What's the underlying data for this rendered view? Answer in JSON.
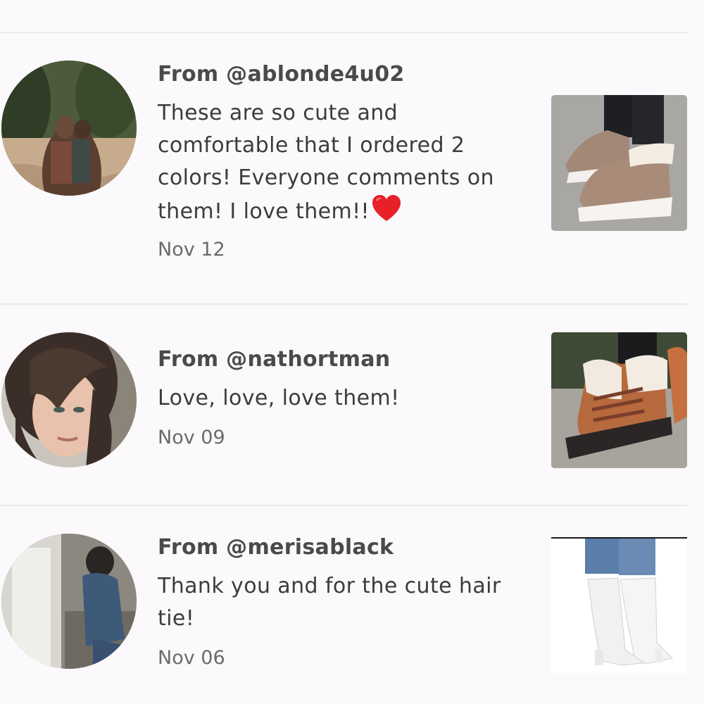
{
  "reviews": [
    {
      "author": "From @ablonde4u02",
      "comment": "These are so cute and comfortable that I ordered 2 colors! Everyone comments on them! I love them!!",
      "emoji": "heart-emoji",
      "date": "Nov 12",
      "avatar": "couple-in-field-photo",
      "product": "tan-fur-wedge-boots-photo"
    },
    {
      "author": "From @nathortman",
      "comment": "Love, love, love them!",
      "date": "Nov 09",
      "avatar": "woman-selfie-photo",
      "product": "brown-lace-up-fur-boots-photo"
    },
    {
      "author": "From @merisablack",
      "comment": "Thank you and for the cute hair tie!",
      "date": "Nov 06",
      "avatar": "person-on-steps-photo",
      "product": "white-heeled-ankle-boots-photo"
    }
  ],
  "colors": {
    "background": "#fbf9fb",
    "divider": "#ebe8eb",
    "author_text": "#4a4a4a",
    "comment_text": "#3c3c3c",
    "date_text": "#6b6b6b",
    "heart": "#e8202a"
  }
}
